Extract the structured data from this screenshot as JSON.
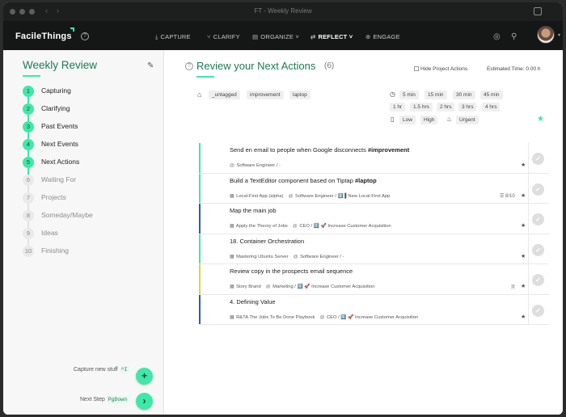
{
  "window": {
    "title": "FT - Weekly Review"
  },
  "nav": {
    "logo": "FacileThings",
    "items": [
      {
        "label": "CAPTURE",
        "icon": "capture-icon"
      },
      {
        "label": "CLARIFY",
        "icon": "clarify-icon"
      },
      {
        "label": "ORGANIZE",
        "icon": "organize-icon"
      },
      {
        "label": "REFLECT",
        "icon": "reflect-icon",
        "active": true
      },
      {
        "label": "ENGAGE",
        "icon": "engage-icon"
      }
    ]
  },
  "sidebar": {
    "title": "Weekly Review",
    "steps": [
      {
        "num": "1",
        "label": "Capturing",
        "done": true
      },
      {
        "num": "2",
        "label": "Clarifying",
        "done": true
      },
      {
        "num": "3",
        "label": "Past Events",
        "done": true
      },
      {
        "num": "4",
        "label": "Next Events",
        "done": true
      },
      {
        "num": "5",
        "label": "Next Actions",
        "done": true
      },
      {
        "num": "6",
        "label": "Waiting For",
        "done": false
      },
      {
        "num": "7",
        "label": "Projects",
        "done": false
      },
      {
        "num": "8",
        "label": "Someday/Maybe",
        "done": false
      },
      {
        "num": "9",
        "label": "Ideas",
        "done": false
      },
      {
        "num": "10",
        "label": "Finishing",
        "done": false
      }
    ],
    "capture_label": "Capture new stuff",
    "capture_key": "^I",
    "next_label": "Next Step",
    "next_key": "PgDown"
  },
  "main": {
    "title": "Review your Next Actions",
    "count": "(6)",
    "hide_projects": "Hide Project Actions",
    "estimated": "Estimated Time: 0.00 h",
    "tags": [
      "_untagged",
      "improvement",
      "laptop"
    ],
    "time_chips_row1": [
      "5 min",
      "15 min",
      "30 min",
      "45 min"
    ],
    "time_chips_row2": [
      "1 hr",
      "1.5 hrs",
      "2 hrs",
      "3 hrs",
      "4 hrs"
    ],
    "energy_chips": [
      "Low",
      "High"
    ],
    "urgent_chip": "Urgent"
  },
  "actions": [
    {
      "title": "Send en email to people when Google disconnects",
      "tag": "#improvement",
      "color": "#3ee8a8",
      "meta": [
        {
          "icon": "@",
          "text": "Software Engineer / -"
        }
      ],
      "extra": ""
    },
    {
      "title": "Build a TextEditor component based on Tiptap",
      "tag": "#laptop",
      "color": "#3ee8a8",
      "meta": [
        {
          "icon": "▦",
          "text": "Local-First App (alpha)"
        },
        {
          "icon": "@",
          "text": "Software Engineer / 2️⃣ ▌New Local-First App"
        }
      ],
      "extra": "☰ 8/10"
    },
    {
      "title": "Map the main job",
      "tag": "",
      "color": "#2f5da8",
      "meta": [
        {
          "icon": "▦",
          "text": "Apply the Theory of Jobs"
        },
        {
          "icon": "@",
          "text": "CEO / 1️⃣ 🚀 Increase Customer Acquisition"
        }
      ],
      "extra": ""
    },
    {
      "title": "18. Container Orchestration",
      "tag": "",
      "color": "#3ee8a8",
      "meta": [
        {
          "icon": "▦",
          "text": "Mastering Ubuntu Server"
        },
        {
          "icon": "@",
          "text": "Software Engineer / -"
        }
      ],
      "extra": ""
    },
    {
      "title": "Review copy in the prospects email sequence",
      "tag": "",
      "color": "#d6d83c",
      "meta": [
        {
          "icon": "▦",
          "text": "Story Brand"
        },
        {
          "icon": "@",
          "text": "Marketing / 1️⃣ 🚀 Increase Customer Acquisition"
        }
      ],
      "extra": "🗎"
    },
    {
      "title": "4. Defining Value",
      "tag": "",
      "color": "#2f5da8",
      "meta": [
        {
          "icon": "▦",
          "text": "R&TA The Jobs To Be Done Playbook"
        },
        {
          "icon": "@",
          "text": "CEO / 1️⃣ 🚀 Increase Customer Acquisition"
        }
      ],
      "extra": ""
    }
  ]
}
